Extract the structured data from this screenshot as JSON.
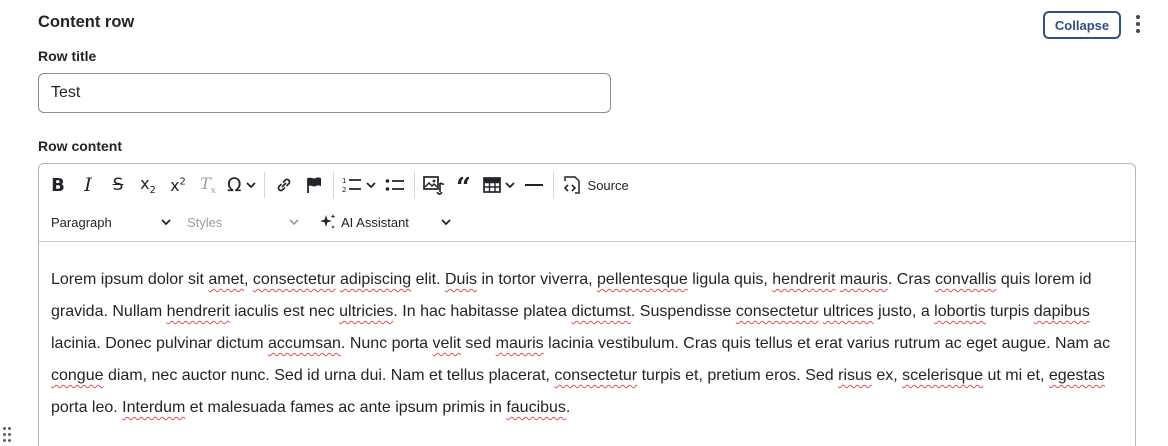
{
  "section": {
    "title": "Content row",
    "collapse_label": "Collapse"
  },
  "row_title": {
    "label": "Row title",
    "value": "Test"
  },
  "row_content": {
    "label": "Row content",
    "toolbar": {
      "row1": [
        "bold-icon",
        "italic-icon",
        "strikethrough-icon",
        "subscript-icon",
        "superscript-icon",
        "remove-format-icon",
        "special-characters-icon",
        "link-icon",
        "flag-icon",
        "numbered-list-icon",
        "bulleted-list-icon",
        "media-icon",
        "blockquote-icon",
        "table-icon",
        "horizontal-line-icon",
        "source-icon"
      ],
      "source_label": "Source",
      "paragraph_label": "Paragraph",
      "styles_label": "Styles",
      "ai_label": "AI Assistant"
    },
    "content_segments": [
      {
        "t": "Lorem ipsum dolor sit "
      },
      {
        "t": "amet",
        "s": true
      },
      {
        "t": ", "
      },
      {
        "t": "consectetur",
        "s": true
      },
      {
        "t": " "
      },
      {
        "t": "adipiscing",
        "s": true
      },
      {
        "t": " elit. "
      },
      {
        "t": "Duis",
        "s": true
      },
      {
        "t": " in tortor viverra, "
      },
      {
        "t": "pellentesque",
        "s": true
      },
      {
        "t": " ligula quis, "
      },
      {
        "t": "hendrerit",
        "s": true
      },
      {
        "t": " "
      },
      {
        "t": "mauris",
        "s": true
      },
      {
        "t": ". Cras "
      },
      {
        "t": "convallis",
        "s": true
      },
      {
        "t": " quis lorem id gravida. Nullam "
      },
      {
        "t": "hendrerit",
        "s": true
      },
      {
        "t": " iaculis est nec "
      },
      {
        "t": "ultricies",
        "s": true
      },
      {
        "t": ". In hac habitasse platea "
      },
      {
        "t": "dictumst",
        "s": true
      },
      {
        "t": ". Suspendisse "
      },
      {
        "t": "consectetur",
        "s": true
      },
      {
        "t": " "
      },
      {
        "t": "ultrices",
        "s": true
      },
      {
        "t": " justo, a "
      },
      {
        "t": "lobortis",
        "s": true
      },
      {
        "t": " turpis "
      },
      {
        "t": "dapibus",
        "s": true
      },
      {
        "t": " lacinia. Donec pulvinar dictum "
      },
      {
        "t": "accumsan",
        "s": true
      },
      {
        "t": ". Nunc porta "
      },
      {
        "t": "velit",
        "s": true
      },
      {
        "t": " sed "
      },
      {
        "t": "mauris",
        "s": true
      },
      {
        "t": " lacinia vestibulum. Cras quis tellus et erat varius rutrum ac eget augue. Nam ac "
      },
      {
        "t": "congue",
        "s": true
      },
      {
        "t": " diam, nec auctor nunc. Sed id urna dui. Nam et tellus placerat, "
      },
      {
        "t": "consectetur",
        "s": true
      },
      {
        "t": " turpis et, pretium eros. Sed "
      },
      {
        "t": "risus",
        "s": true
      },
      {
        "t": " ex, "
      },
      {
        "t": "scelerisque",
        "s": true
      },
      {
        "t": " ut mi et, "
      },
      {
        "t": "egestas",
        "s": true
      },
      {
        "t": " porta leo. "
      },
      {
        "t": "Interdum",
        "s": true
      },
      {
        "t": " et malesuada fames ac ante ipsum primis in "
      },
      {
        "t": "faucibus",
        "s": true
      },
      {
        "t": "."
      }
    ]
  },
  "colors": {
    "accent": "#2f4f86",
    "text": "#232429",
    "muted": "#9a9ca3",
    "spell_error": "#d9534f"
  }
}
